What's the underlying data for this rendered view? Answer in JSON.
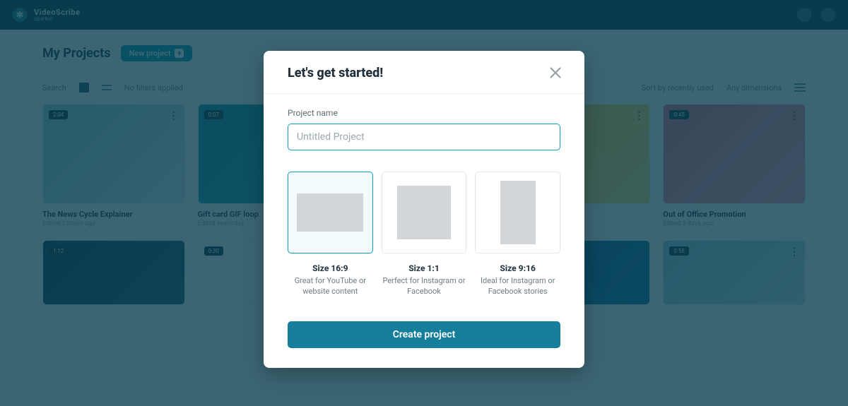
{
  "header": {
    "brand": "VideoScribe",
    "brand_sub": "sparkol"
  },
  "page": {
    "title": "My Projects",
    "new_project_label": "New project"
  },
  "toolbar": {
    "search_placeholder": "Search",
    "filter_label": "No filters applied",
    "sort_label": "Sort by recently used",
    "dimensions_label": "Any dimensions"
  },
  "modal": {
    "title": "Let's get started!",
    "project_name_label": "Project name",
    "project_name_placeholder": "Untitled Project",
    "project_name_value": "",
    "sizes": [
      {
        "title": "Size 16:9",
        "sub": "Great for YouTube or website content",
        "ratio": "r169",
        "selected": true
      },
      {
        "title": "Size 1:1",
        "sub": "Perfect for Instagram or Facebook",
        "ratio": "r11",
        "selected": false
      },
      {
        "title": "Size 9:16",
        "sub": "Ideal for Instagram or Facebook stories",
        "ratio": "r916",
        "selected": false
      }
    ],
    "create_label": "Create project"
  },
  "cards_row1": [
    {
      "title": "The News Cycle Explainer",
      "sub": "Edited 2 hours ago",
      "badge": "2:04"
    },
    {
      "title": "Gift card GIF loop",
      "sub": "Edited yesterday",
      "badge": "0:07"
    },
    {
      "title": "",
      "sub": "",
      "badge": ""
    },
    {
      "title": "",
      "sub": "",
      "badge": ""
    },
    {
      "title": "Out of Office Promotion",
      "sub": "Edited 3 days ago",
      "badge": "0:45"
    }
  ],
  "cards_row2": [
    {
      "badge": "1:12"
    },
    {
      "badge": "0:30"
    },
    {
      "badge": ""
    },
    {
      "badge": ""
    },
    {
      "badge": "0:58"
    }
  ]
}
